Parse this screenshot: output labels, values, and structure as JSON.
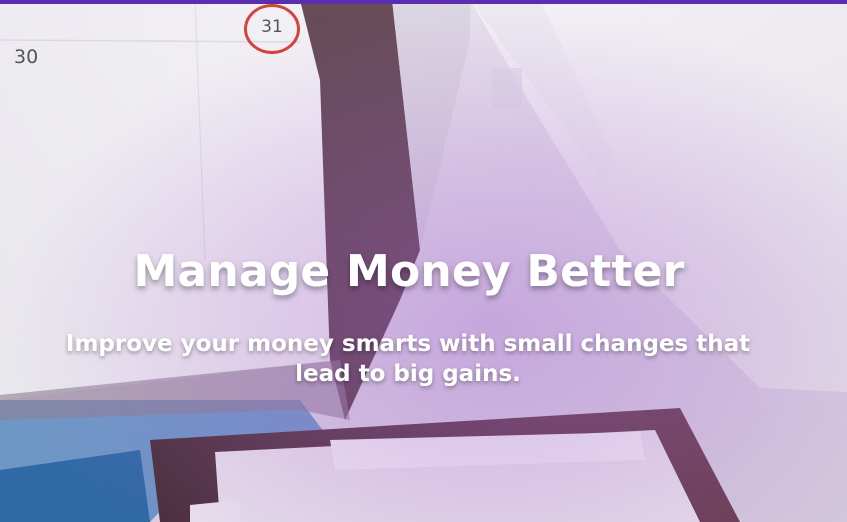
{
  "hero": {
    "title": "Manage Money Better",
    "subtitle": "Improve your money smarts with small changes that lead to big gains."
  },
  "background": {
    "calendar_day_left": "30",
    "calendar_day_circled": "31"
  },
  "colors": {
    "top_strip": "#5b2db0",
    "overlay_purple": "#a560d2",
    "text": "#ffffff",
    "circle_mark": "#d2443d"
  }
}
